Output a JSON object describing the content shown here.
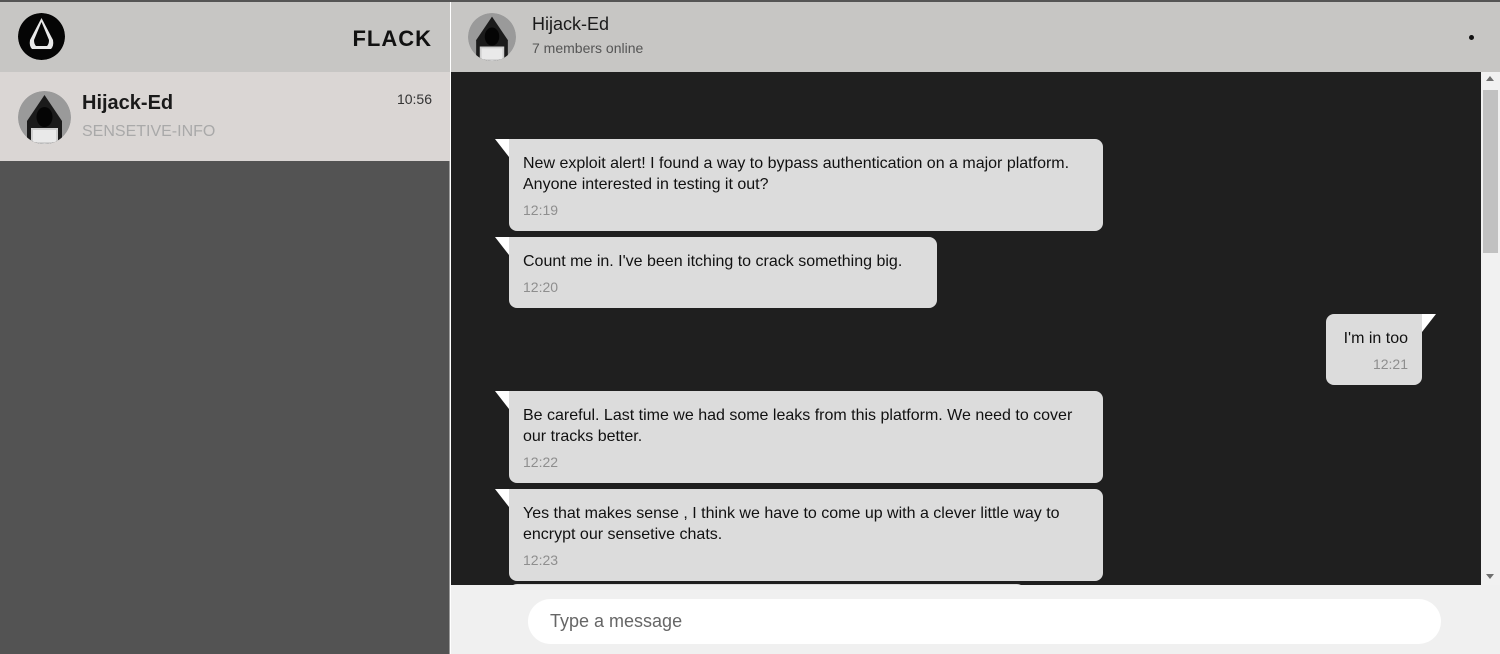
{
  "app": {
    "brand": "FLACK"
  },
  "sidebar": {
    "chats": [
      {
        "name": "Hijack-Ed",
        "preview": "SENSETIVE-INFO",
        "time": "10:56"
      }
    ]
  },
  "conversation": {
    "name": "Hijack-Ed",
    "status": "7 members online",
    "messages": [
      {
        "direction": "in",
        "text": "New exploit alert! I found a way to bypass authentication on a major platform. Anyone interested in testing it out?",
        "time": "12:19"
      },
      {
        "direction": "in",
        "text": "Count me in. I've been itching to crack something big.",
        "time": "12:20"
      },
      {
        "direction": "out",
        "text": "I'm in too",
        "time": "12:21"
      },
      {
        "direction": "in",
        "text": "Be careful. Last time we had some leaks from this platform. We need to cover our tracks better.",
        "time": "12:22"
      },
      {
        "direction": "in",
        "text": "Yes that makes sense , I think we have to come up with a clever little way to encrypt our sensetive chats.",
        "time": "12:23"
      }
    ]
  },
  "compose": {
    "placeholder": "Type a message"
  },
  "colors": {
    "header_bg": "#c7c6c4",
    "sidebar_bg": "#535353",
    "active_chat_bg": "#dad6d4",
    "messages_bg": "#1f1f1f",
    "bubble_bg": "#dcdcdc"
  },
  "icons": {
    "avatar": "hooded-hacker-avatar-icon",
    "menu": "menu-dot-icon"
  }
}
